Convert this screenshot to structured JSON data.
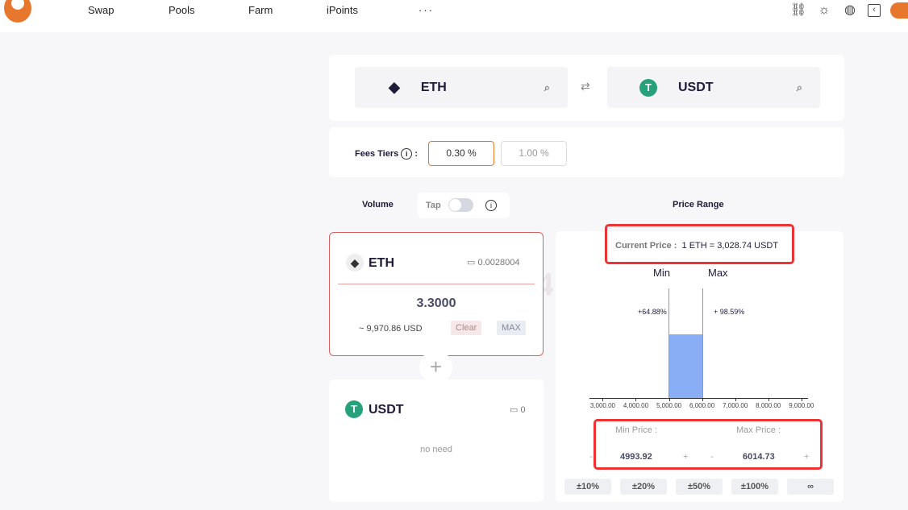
{
  "nav": {
    "items": [
      "Swap",
      "Pools",
      "Farm",
      "iPoints"
    ],
    "more": "···",
    "icons": [
      "unlink-icon",
      "sun-icon",
      "globe-icon",
      "collapse-panel-icon",
      "account-icon"
    ]
  },
  "pair": {
    "from": "ETH",
    "to": "USDT"
  },
  "fees": {
    "label": "Fees Tiers",
    "colon": ":",
    "options": [
      "0.30 %",
      "1.00 %"
    ],
    "selected": "0.30 %"
  },
  "volume": {
    "label": "Volume",
    "tap_label": "Tap",
    "tap_on": false
  },
  "eth_input": {
    "token": "ETH",
    "balance": "0.0028004",
    "amount": "3.3000",
    "usd": "~ 9,970.86 USD",
    "clear": "Clear",
    "max": "MAX"
  },
  "usdt_input": {
    "token": "USDT",
    "balance": "0",
    "note": "no need"
  },
  "price_range": {
    "label": "Price Range",
    "current_label": "Current Price :",
    "current_value": "1 ETH = 3,028.74 USDT",
    "min_label": "Min",
    "max_label": "Max",
    "min_pct": "+64.88%",
    "max_pct": "+ 98.59%",
    "min_price_label": "Min Price :",
    "max_price_label": "Max Price :",
    "min_price": "4993.92",
    "max_price": "6014.73",
    "minus": "-",
    "plus": "+",
    "presets": [
      "±10%",
      "±20%",
      "±50%",
      "±100%",
      "∞"
    ]
  },
  "chart_data": {
    "type": "bar",
    "ticks": [
      "3,000.00",
      "4,000.00",
      "5,000.00",
      "6,000.00",
      "7,000.00",
      "8,000.00",
      "9,000.00"
    ],
    "xlim": [
      2600,
      9200
    ],
    "range": [
      4993.92,
      6014.73
    ],
    "color": "#8aaef5"
  },
  "watermark": "VX:9336745"
}
